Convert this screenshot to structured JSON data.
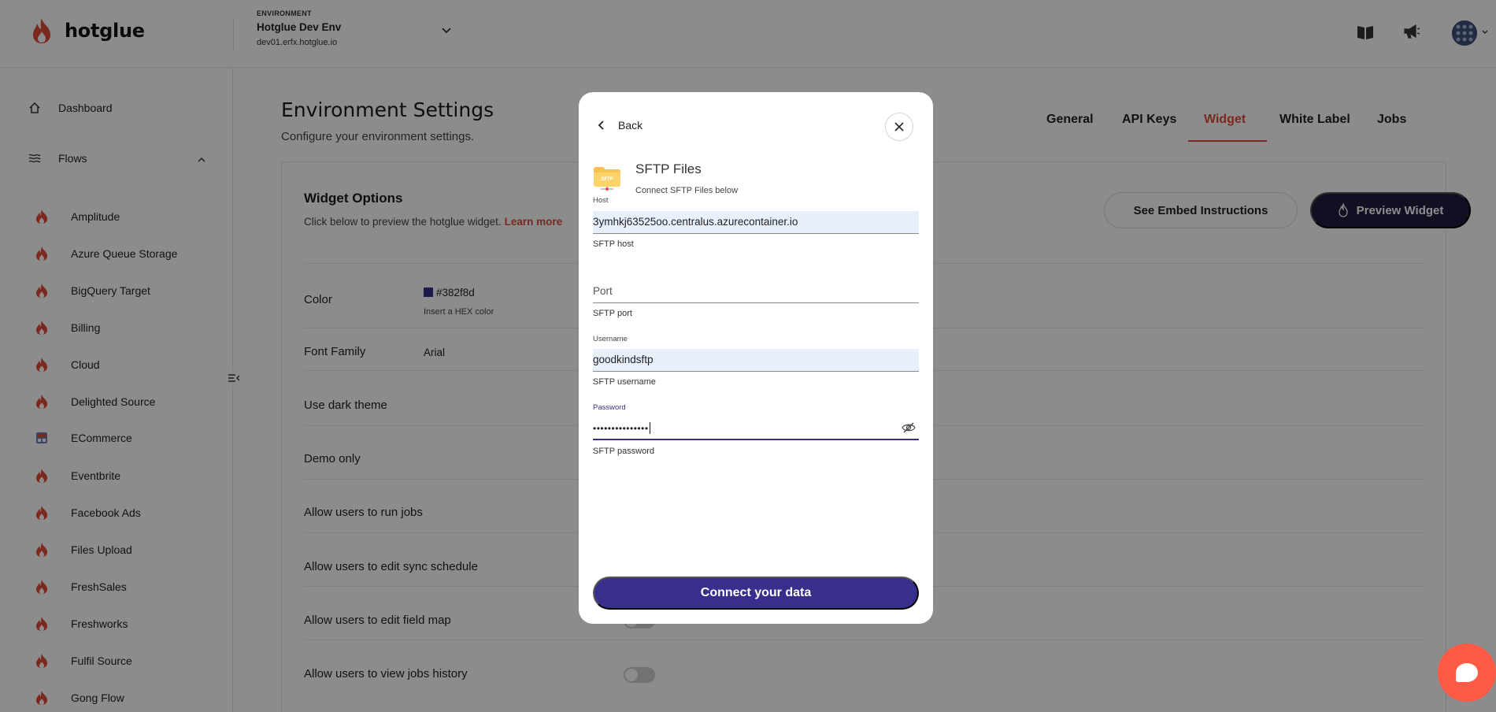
{
  "app": {
    "logo_text": "hotglue"
  },
  "environment": {
    "label": "ENVIRONMENT",
    "name": "Hotglue Dev Env",
    "host": "dev01.erfx.hotglue.io"
  },
  "sidebar": {
    "dashboard": "Dashboard",
    "flows": "Flows",
    "flow_items": [
      "Amplitude",
      "Azure Queue Storage",
      "BigQuery Target",
      "Billing",
      "Cloud",
      "Delighted Source",
      "ECommerce",
      "Eventbrite",
      "Facebook Ads",
      "Files Upload",
      "FreshSales",
      "Freshworks",
      "Fulfil Source",
      "Gong Flow"
    ]
  },
  "page": {
    "title": "Environment Settings",
    "subtitle": "Configure your environment settings."
  },
  "tabs": [
    "General",
    "API Keys",
    "Widget",
    "White Label",
    "Jobs"
  ],
  "active_tab": "Widget",
  "widget_options": {
    "title": "Widget Options",
    "subtitle": "Click below to preview the hotglue widget.",
    "learn_more": "Learn more",
    "embed_button": "See Embed Instructions",
    "preview_button": "Preview Widget",
    "color_label": "Color",
    "color_value": "#382f8d",
    "color_help": "Insert a HEX color",
    "font_label": "Font Family",
    "font_value": "Arial",
    "rows": [
      "Use dark theme",
      "Demo only",
      "Allow users to run jobs",
      "Allow users to edit sync schedule",
      "Allow users to edit field map",
      "Allow users to view jobs history"
    ]
  },
  "modal": {
    "back": "Back",
    "connector_name": "SFTP Files",
    "connector_subtitle": "Connect SFTP Files below",
    "icon_text": "SFTP",
    "host_label": "Host",
    "host_value": "3ymhkj63525oo.centralus.azurecontainer.io",
    "host_help": "SFTP host",
    "port_placeholder": "Port",
    "port_help": "SFTP port",
    "username_label": "Username",
    "username_value": "goodkindsftp",
    "username_help": "SFTP username",
    "password_label": "Password",
    "password_value": "•••••••••••••••",
    "password_help": "SFTP password",
    "connect_button": "Connect your data"
  },
  "colors": {
    "accent": "#382f8d",
    "brand": "#e04a39",
    "dark_button": "#1f1d3d",
    "chat": "#ff5a46"
  }
}
